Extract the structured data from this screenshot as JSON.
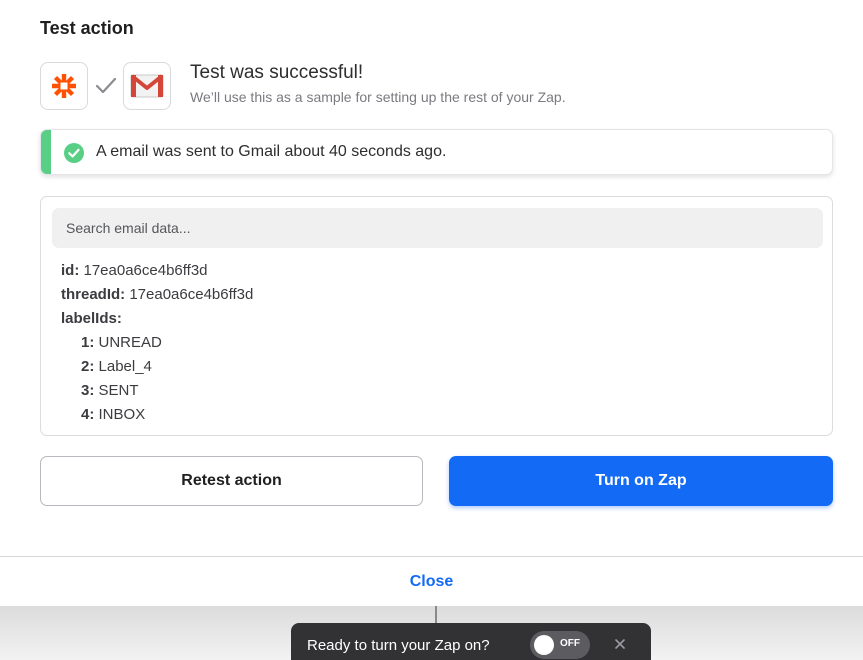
{
  "header": {
    "title": "Test action"
  },
  "result": {
    "title": "Test was successful!",
    "subtitle": "We’ll use this as a sample for setting up the rest of your Zap."
  },
  "alert": {
    "message": "A email was sent to Gmail about 40 seconds ago."
  },
  "search": {
    "placeholder": "Search email data..."
  },
  "data": {
    "id_key": "id:",
    "id_value": "17ea0a6ce4b6ff3d",
    "thread_key": "threadId:",
    "thread_value": "17ea0a6ce4b6ff3d",
    "labels_key": "labelIds:",
    "labels": [
      {
        "key": "1:",
        "value": "UNREAD"
      },
      {
        "key": "2:",
        "value": "Label_4"
      },
      {
        "key": "3:",
        "value": "SENT"
      },
      {
        "key": "4:",
        "value": "INBOX"
      }
    ]
  },
  "buttons": {
    "retest": "Retest action",
    "turn_on": "Turn on Zap"
  },
  "footer": {
    "close": "Close"
  },
  "toast": {
    "message": "Ready to turn your Zap on?",
    "toggle_state": "OFF"
  },
  "icons": {
    "zapier": "zapier-asterisk-icon",
    "check": "checkmark-icon",
    "gmail": "gmail-icon",
    "success": "check-circle-icon",
    "close": "close-icon"
  },
  "colors": {
    "accent": "#136bf5",
    "success": "#58cf84",
    "zapier_orange": "#ff4f00",
    "gmail_red": "#d44638"
  }
}
